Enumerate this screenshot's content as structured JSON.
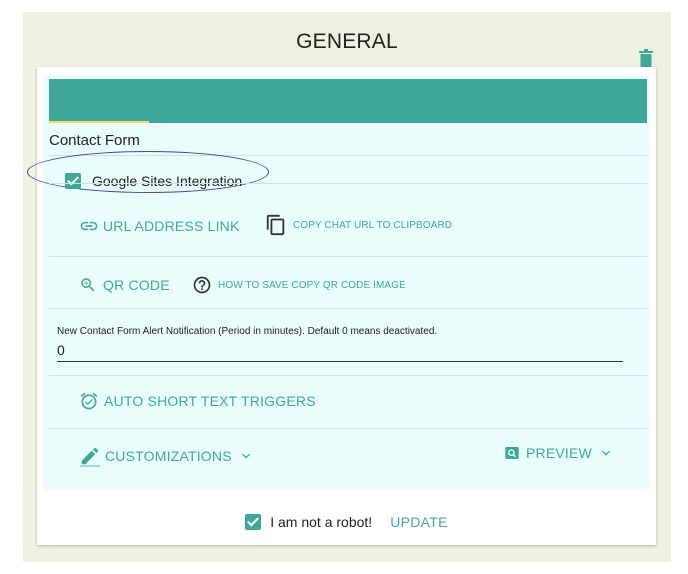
{
  "header": {
    "title": "GENERAL"
  },
  "tabs": [
    {
      "icon": "clipboard-icon",
      "active": true
    },
    {
      "icon": "phone-icon",
      "active": false
    },
    {
      "icon": "video-camera-icon",
      "active": false
    },
    {
      "icon": "mail-icon",
      "active": false
    },
    {
      "icon": "contact-card-icon",
      "active": false
    },
    {
      "icon": "browser-window-icon",
      "active": false
    }
  ],
  "form": {
    "section_title": "Contact Form",
    "google_sites": {
      "label": "Google Sites Integration",
      "checked": true
    },
    "url_link": {
      "label": "URL ADDRESS LINK",
      "copy_label": "COPY CHAT URL TO CLIPBOARD"
    },
    "qr": {
      "label": "QR CODE",
      "help_label": "HOW TO SAVE COPY QR CODE IMAGE"
    },
    "alert": {
      "label": "New Contact Form Alert Notification (Period in minutes). Default 0 means deactivated.",
      "value": "0"
    },
    "auto_short": {
      "label": "AUTO SHORT TEXT TRIGGERS"
    },
    "customizations": {
      "label": "CUSTOMIZATIONS"
    },
    "preview": {
      "label": "PREVIEW"
    }
  },
  "footer": {
    "robot_label": "I am not a robot!",
    "robot_checked": true,
    "update_label": "UPDATE"
  },
  "colors": {
    "accent": "#3fa89b",
    "panel_bg": "#e8fdfc",
    "outer_bg": "#eef3e1",
    "tab_indicator": "#f2e25b"
  }
}
